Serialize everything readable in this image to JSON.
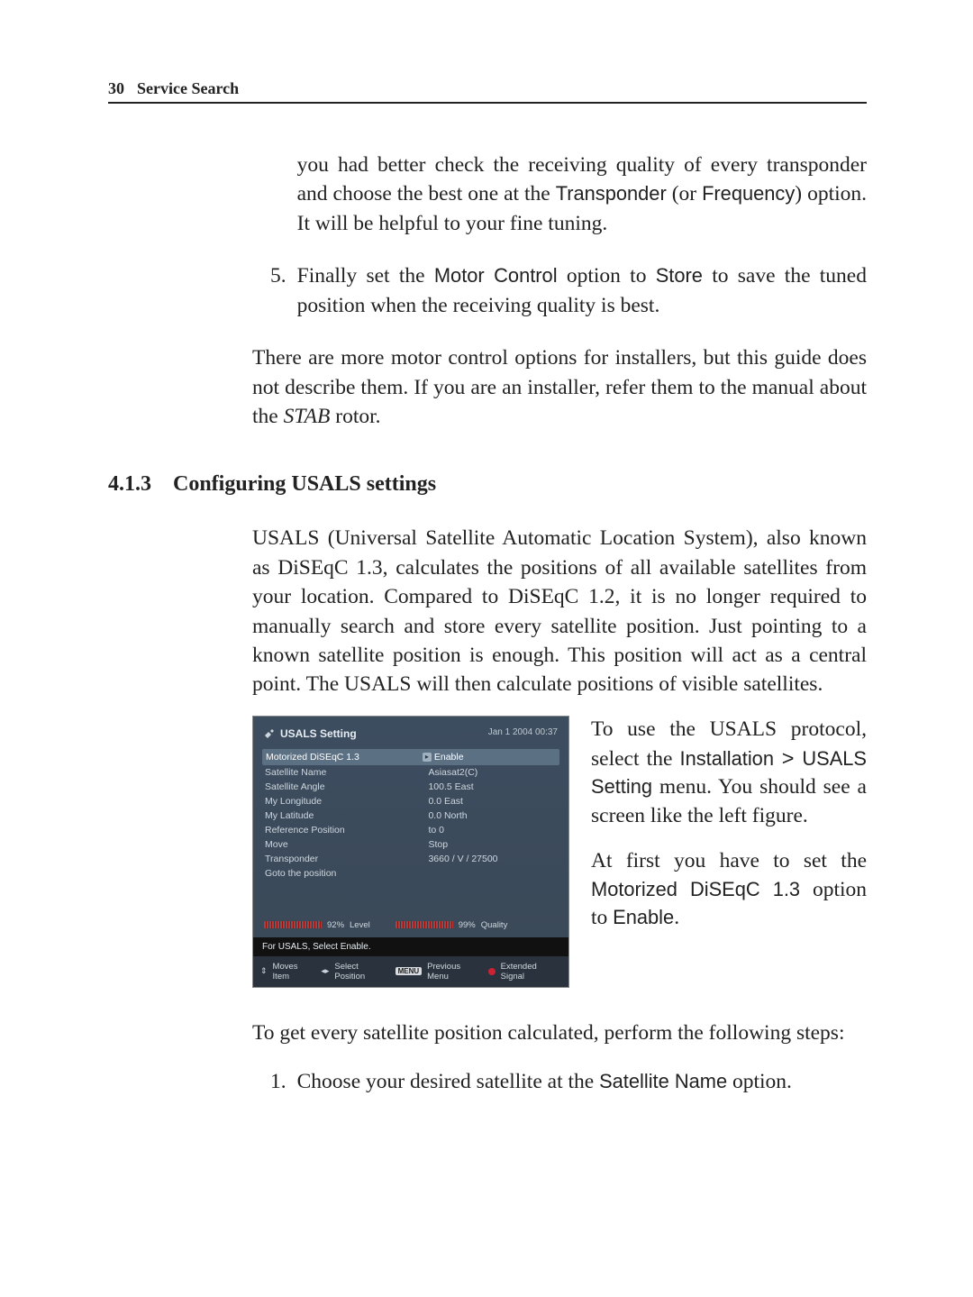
{
  "header": {
    "page_number": "30",
    "chapter": "Service Search"
  },
  "cont": {
    "p1a": "you had better check the receiving quality of every transponder and choose the best one at the ",
    "p1_opt1": "Transponder",
    "p1_mid": " (or ",
    "p1_opt2": "Frequency",
    "p1b": ") option. It will be helpful to your fine tuning."
  },
  "item5": {
    "num": "5.",
    "a": "Finally set the ",
    "opt1": "Motor Control",
    "b": " option to ",
    "opt2": "Store",
    "c": " to save the tuned position when the receiving quality is best."
  },
  "para_more": {
    "a": "There are more motor control options for installers, but this guide does not describe them. If you are an installer, refer them to the manual about the ",
    "stab": "STAB",
    "b": " rotor."
  },
  "section": {
    "num": "4.1.3",
    "title": "Configuring USALS settings"
  },
  "usals_intro": "USALS (Universal Satellite Automatic Location System), also known as DiSEqC 1.3, calculates the positions of all available satellites from your location. Compared to DiSEqC 1.2, it is no longer required to manually search and store every satellite position. Just pointing to a known satellite position is enough. This position will act as a central point. The USALS will then calculate positions of visible satellites.",
  "right1": {
    "a": "To use the USALS protocol, select the ",
    "m1": "Installation",
    "gt": " > ",
    "m2": "USALS Setting",
    "b": " menu. You should see a screen like the left figure."
  },
  "right2": {
    "a": "At first you have to set the ",
    "opt1": "Motorized DiSEqC 1.3",
    "b": " option to ",
    "opt2": "Enable",
    "c": "."
  },
  "after": "To get every satellite position calculated, perform the following steps:",
  "step1": {
    "num": "1.",
    "a": "Choose your desired satellite at the ",
    "opt": "Satellite Name",
    "b": " option."
  },
  "osd": {
    "title": "USALS Setting",
    "datetime": "Jan 1 2004 00:37",
    "rows": [
      {
        "label": "Motorized DiSEqC 1.3",
        "value": "Enable",
        "hl": true,
        "arrow": true
      },
      {
        "label": "Satellite Name",
        "value": "Asiasat2(C)"
      },
      {
        "label": "Satellite Angle",
        "value": "100.5 East"
      },
      {
        "label": "My Longitude",
        "value": "0.0 East"
      },
      {
        "label": "My Latitude",
        "value": "0.0 North"
      },
      {
        "label": "Reference Position",
        "value": "to 0"
      },
      {
        "label": "Move",
        "value": "Stop"
      },
      {
        "label": "Transponder",
        "value": "3660 / V / 27500"
      },
      {
        "label": "Goto the position",
        "value": ""
      }
    ],
    "meter1_pct": "92%",
    "meter1_lbl": "Level",
    "meter2_pct": "99%",
    "meter2_lbl": "Quality",
    "footer1": "For USALS, Select Enable.",
    "hint_moves": "Moves Item",
    "hint_select": "Select Position",
    "chip_menu": "MENU",
    "hint_prev": "Previous Menu",
    "hint_ext": "Extended Signal"
  }
}
